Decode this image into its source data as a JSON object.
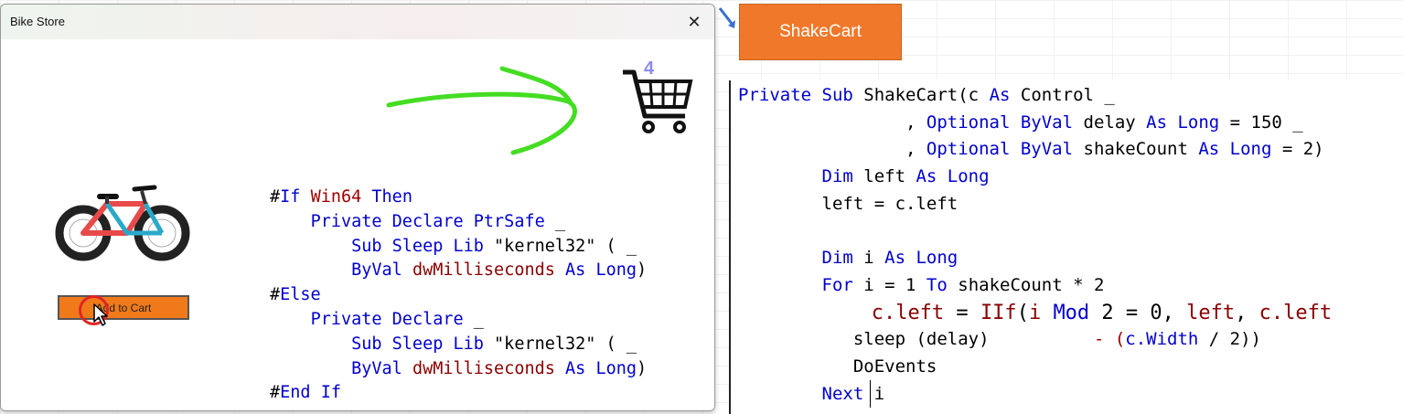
{
  "window": {
    "title": "Bike Store",
    "close_glyph": "✕",
    "cart_count": "4",
    "add_button_label": "Add to Cart"
  },
  "shake_label": "ShakeCart",
  "code_left": [
    [
      {
        "t": "#",
        "c": "plain"
      },
      {
        "t": "If",
        "c": "kw"
      },
      {
        "t": " ",
        "c": "plain"
      },
      {
        "t": "Win64",
        "c": "red"
      },
      {
        "t": " ",
        "c": "plain"
      },
      {
        "t": "Then",
        "c": "kw"
      }
    ],
    [
      {
        "t": "    ",
        "c": "plain"
      },
      {
        "t": "Private Declare PtrSafe",
        "c": "kw"
      },
      {
        "t": " _",
        "c": "plain"
      }
    ],
    [
      {
        "t": "        ",
        "c": "plain"
      },
      {
        "t": "Sub Sleep Lib",
        "c": "kw"
      },
      {
        "t": " \"kernel32\" ( _",
        "c": "plain"
      }
    ],
    [
      {
        "t": "        ",
        "c": "plain"
      },
      {
        "t": "ByVal",
        "c": "kw"
      },
      {
        "t": " ",
        "c": "plain"
      },
      {
        "t": "dwMilliseconds",
        "c": "id"
      },
      {
        "t": " ",
        "c": "plain"
      },
      {
        "t": "As Long",
        "c": "kw"
      },
      {
        "t": ")",
        "c": "plain"
      }
    ],
    [
      {
        "t": "#",
        "c": "plain"
      },
      {
        "t": "Else",
        "c": "kw"
      }
    ],
    [
      {
        "t": "    ",
        "c": "plain"
      },
      {
        "t": "Private Declare",
        "c": "kw"
      },
      {
        "t": " _",
        "c": "plain"
      }
    ],
    [
      {
        "t": "        ",
        "c": "plain"
      },
      {
        "t": "Sub Sleep Lib",
        "c": "kw"
      },
      {
        "t": " \"kernel32\" ( _",
        "c": "plain"
      }
    ],
    [
      {
        "t": "        ",
        "c": "plain"
      },
      {
        "t": "ByVal",
        "c": "kw"
      },
      {
        "t": " ",
        "c": "plain"
      },
      {
        "t": "dwMilliseconds",
        "c": "id"
      },
      {
        "t": " ",
        "c": "plain"
      },
      {
        "t": "As Long",
        "c": "kw"
      },
      {
        "t": ")",
        "c": "plain"
      }
    ],
    [
      {
        "t": "#",
        "c": "plain"
      },
      {
        "t": "End If",
        "c": "kw"
      }
    ]
  ],
  "code_right": [
    {
      "size": "n",
      "parts": [
        {
          "t": "Private Sub",
          "c": "kw"
        },
        {
          "t": " ShakeCart(c ",
          "c": "plain"
        },
        {
          "t": "As",
          "c": "kw"
        },
        {
          "t": " Control _",
          "c": "plain"
        }
      ]
    },
    {
      "size": "n",
      "parts": [
        {
          "t": "                , ",
          "c": "plain"
        },
        {
          "t": "Optional ByVal",
          "c": "kw"
        },
        {
          "t": " delay ",
          "c": "plain"
        },
        {
          "t": "As Long",
          "c": "kw"
        },
        {
          "t": " = 150 _",
          "c": "plain"
        }
      ]
    },
    {
      "size": "n",
      "parts": [
        {
          "t": "                , ",
          "c": "plain"
        },
        {
          "t": "Optional ByVal",
          "c": "kw"
        },
        {
          "t": " shakeCount ",
          "c": "plain"
        },
        {
          "t": "As Long",
          "c": "kw"
        },
        {
          "t": " = 2)",
          "c": "plain"
        }
      ]
    },
    {
      "size": "n",
      "parts": [
        {
          "t": "        ",
          "c": "plain"
        },
        {
          "t": "Dim",
          "c": "kw"
        },
        {
          "t": " left ",
          "c": "plain"
        },
        {
          "t": "As Long",
          "c": "kw"
        }
      ]
    },
    {
      "size": "n",
      "parts": [
        {
          "t": "        left = c.left",
          "c": "plain"
        }
      ]
    },
    {
      "size": "n",
      "parts": [
        {
          "t": "",
          "c": "plain"
        }
      ]
    },
    {
      "size": "n",
      "parts": [
        {
          "t": "        ",
          "c": "plain"
        },
        {
          "t": "Dim",
          "c": "kw"
        },
        {
          "t": " i ",
          "c": "plain"
        },
        {
          "t": "As Long",
          "c": "kw"
        }
      ]
    },
    {
      "size": "n",
      "parts": [
        {
          "t": "        ",
          "c": "plain"
        },
        {
          "t": "For",
          "c": "kw"
        },
        {
          "t": " i = 1 ",
          "c": "plain"
        },
        {
          "t": "To",
          "c": "kw"
        },
        {
          "t": " shakeCount * 2",
          "c": "plain"
        }
      ]
    },
    {
      "size": "b",
      "parts": [
        {
          "t": "           ",
          "c": "plain"
        },
        {
          "t": "c.left",
          "c": "id"
        },
        {
          "t": " = ",
          "c": "plain"
        },
        {
          "t": "IIf",
          "c": "id"
        },
        {
          "t": "(",
          "c": "plain"
        },
        {
          "t": "i",
          "c": "id"
        },
        {
          "t": " ",
          "c": "plain"
        },
        {
          "t": "Mod",
          "c": "kw"
        },
        {
          "t": " 2 = 0, ",
          "c": "plain"
        },
        {
          "t": "left",
          "c": "id"
        },
        {
          "t": ", ",
          "c": "plain"
        },
        {
          "t": "c.left",
          "c": "id"
        }
      ]
    },
    {
      "size": "n",
      "parts": [
        {
          "t": "           sleep (delay)          ",
          "c": "plain"
        },
        {
          "t": "- (",
          "c": "red"
        },
        {
          "t": "c.Width",
          "c": "kw"
        },
        {
          "t": " / 2))",
          "c": "plain"
        }
      ]
    },
    {
      "size": "n",
      "parts": [
        {
          "t": "           DoEvents",
          "c": "plain"
        }
      ]
    },
    {
      "size": "n",
      "parts": [
        {
          "t": "        ",
          "c": "plain"
        },
        {
          "t": "Next",
          "c": "kw"
        },
        {
          "t": " i",
          "c": "plain"
        }
      ]
    }
  ],
  "colors": {
    "accent_orange": "#f0782a",
    "keyword_blue": "#0000d0",
    "identifier_red": "#8b0000",
    "cart_count": "#8b8bf0",
    "arrow_green": "#44dd22"
  }
}
